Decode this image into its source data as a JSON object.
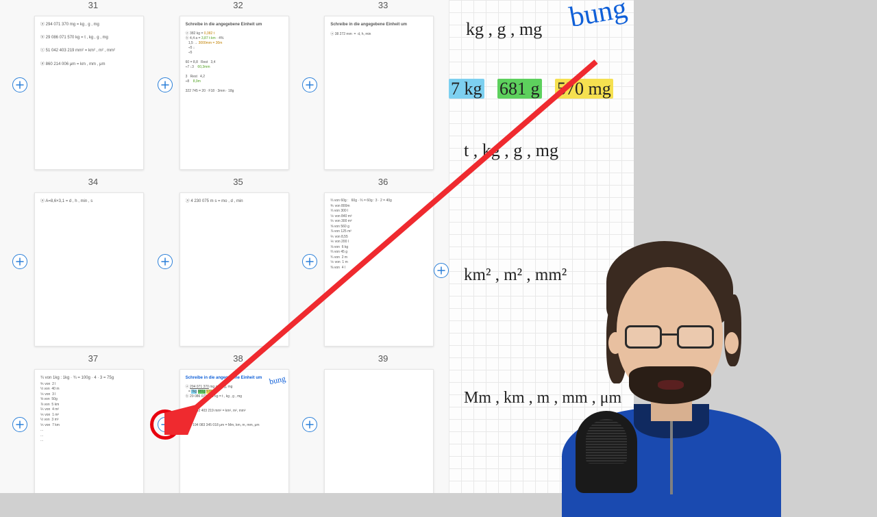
{
  "thumbs": {
    "row1": [
      "31",
      "32",
      "33"
    ],
    "row2": [
      "34",
      "35",
      "36"
    ],
    "row3": [
      "37",
      "38",
      "39"
    ]
  },
  "preview": {
    "heading_fragment": "bung",
    "line1": "kg , g , mg",
    "line2_a": "7 kg",
    "line2_b": "681 g",
    "line2_c": "570 mg",
    "line3": "t , kg , g , mg",
    "line4": "km² , m² , mm²",
    "line5": "Mm , km , m , mm , μm"
  },
  "thumb_samples": {
    "p31_l1": "ⓐ  294 071 370 mg   =    kg , g , mg",
    "p31_l2": "ⓑ  29 086 071 570 kg   =    t , kg , g , mg",
    "p31_l3": "ⓒ  51 042 403 219 mm²   =    km² , m² , mm²",
    "p31_l4": "ⓓ  860 214 006 μm   =    km , mm , μm",
    "p32_h": "Schreibe in die angegebene Einheit um",
    "p34_l1": "ⓐ  A=8,6×3,1   =    d , h , min , s",
    "p35_l1": "ⓐ  4 230 075 m s   =    mo , d , min",
    "p37_l1": "¾  von  1kg :   1kg · ¾ = 100g · 4 · 3 = 75g",
    "p38_h": "Schreibe in die angegebene Einheit um"
  },
  "icons": {
    "plus": "plus"
  }
}
